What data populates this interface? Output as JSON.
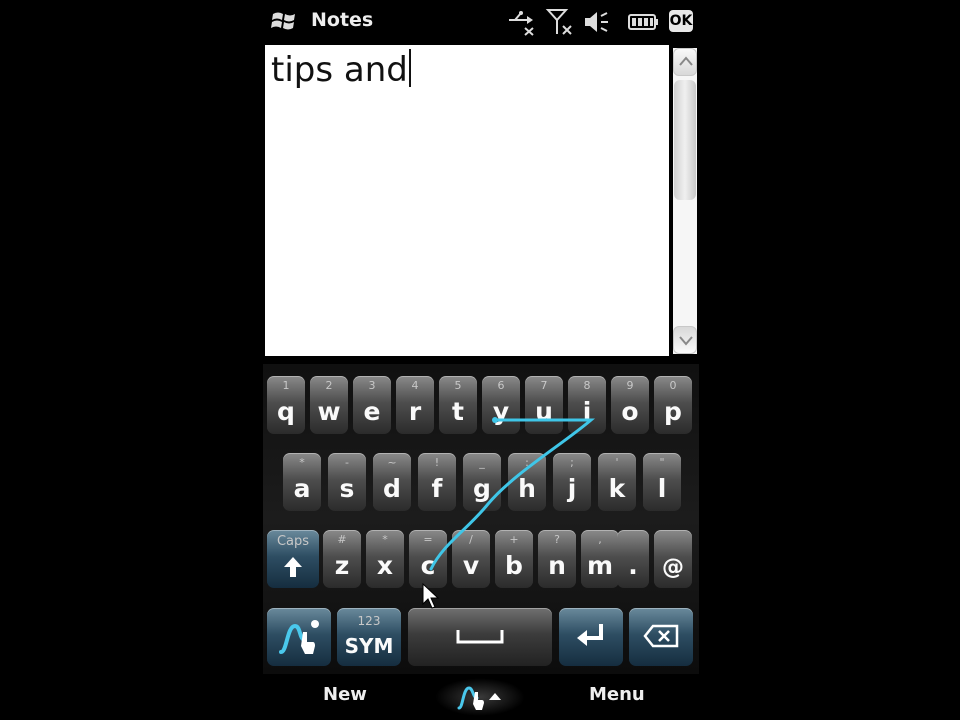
{
  "status_bar": {
    "app_title": "Notes",
    "ok_label": "OK",
    "icons": [
      "windows-flag-icon",
      "connectivity-icon",
      "signal-off-icon",
      "volume-icon",
      "battery-icon"
    ]
  },
  "note": {
    "text": "tips and"
  },
  "keyboard": {
    "row1": [
      {
        "main": "q",
        "sub": "1"
      },
      {
        "main": "w",
        "sub": "2"
      },
      {
        "main": "e",
        "sub": "3"
      },
      {
        "main": "r",
        "sub": "4"
      },
      {
        "main": "t",
        "sub": "5"
      },
      {
        "main": "y",
        "sub": "6"
      },
      {
        "main": "u",
        "sub": "7"
      },
      {
        "main": "i",
        "sub": "8"
      },
      {
        "main": "o",
        "sub": "9"
      },
      {
        "main": "p",
        "sub": "0"
      }
    ],
    "row2": [
      {
        "main": "a",
        "sub": "*"
      },
      {
        "main": "s",
        "sub": "-"
      },
      {
        "main": "d",
        "sub": "~"
      },
      {
        "main": "f",
        "sub": "!"
      },
      {
        "main": "g",
        "sub": "_"
      },
      {
        "main": "h",
        "sub": ":"
      },
      {
        "main": "j",
        "sub": ";"
      },
      {
        "main": "k",
        "sub": "'"
      },
      {
        "main": "l",
        "sub": "\""
      }
    ],
    "row3": [
      {
        "main": "z",
        "sub": "#"
      },
      {
        "main": "x",
        "sub": "*"
      },
      {
        "main": "c",
        "sub": "="
      },
      {
        "main": "v",
        "sub": "/"
      },
      {
        "main": "b",
        "sub": "+"
      },
      {
        "main": "n",
        "sub": "?"
      },
      {
        "main": "m",
        "sub": ","
      },
      {
        "main": ".",
        "sub": ""
      },
      {
        "main": "@",
        "sub": ""
      }
    ],
    "caps_label": "Caps",
    "sym_sub": "123",
    "sym_label": "SYM"
  },
  "softkeys": {
    "left": "New",
    "right": "Menu"
  },
  "colors": {
    "swype_trace": "#3fc6e8",
    "background": "#000000"
  }
}
